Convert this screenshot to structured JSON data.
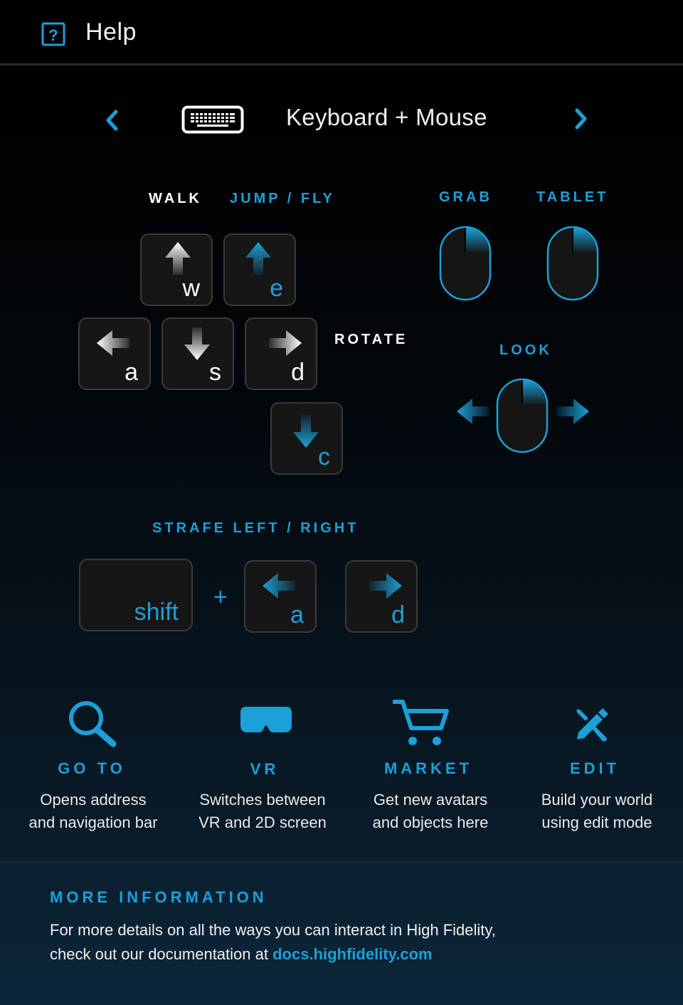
{
  "window": {
    "title": "Help",
    "help_icon": "question-mark-icon"
  },
  "nav": {
    "title": "Keyboard + Mouse",
    "prev_icon": "chevron-left-icon",
    "next_icon": "chevron-right-icon",
    "mode_icon": "keyboard-icon"
  },
  "labels": {
    "walk": "WALK",
    "jump_fly": "JUMP / FLY",
    "rotate": "ROTATE",
    "grab": "GRAB",
    "tablet": "TABLET",
    "look": "LOOK",
    "strafe": "STRAFE LEFT / RIGHT",
    "plus": "+"
  },
  "keys": {
    "w": "w",
    "e": "e",
    "a": "a",
    "s": "s",
    "d": "d",
    "c": "c",
    "shift": "shift",
    "strafe_a": "a",
    "strafe_d": "d"
  },
  "features": [
    {
      "title": "GO TO",
      "desc1": "Opens address",
      "desc2": "and navigation bar",
      "icon": "search-icon"
    },
    {
      "title": "VR",
      "desc1": "Switches between",
      "desc2": "VR and 2D screen",
      "icon": "vr-headset-icon"
    },
    {
      "title": "MARKET",
      "desc1": "Get new avatars",
      "desc2": "and objects here",
      "icon": "cart-icon"
    },
    {
      "title": "EDIT",
      "desc1": "Build your world",
      "desc2": "using edit mode",
      "icon": "edit-tools-icon"
    }
  ],
  "more_info": {
    "title": "MORE INFORMATION",
    "line1": "For more details on all the ways you can interact in High Fidelity,",
    "line2_prefix": "check out our documentation at ",
    "link": "docs.highfidelity.com"
  },
  "colors": {
    "accent": "#1ba0d8",
    "key_bg": "#161616",
    "background": "#000000"
  }
}
